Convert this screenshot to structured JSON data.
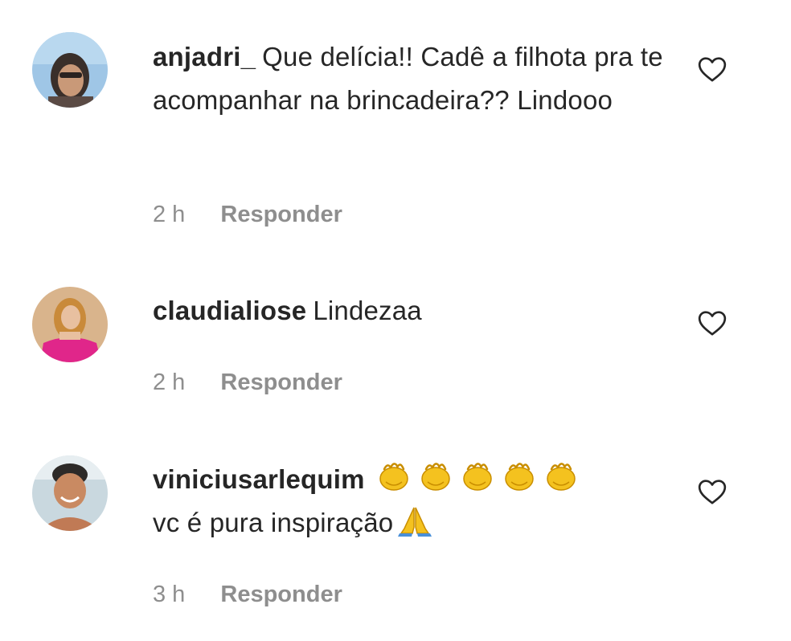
{
  "comments": [
    {
      "username": "anjadri_",
      "text": "Que delícia!! Cadê a filhota pra te acompanhar na brincadeira?? Lindooo",
      "time": "2 h",
      "reply_label": "Responder",
      "avatar_icon": "user-avatar-photo",
      "like_icon": "heart-outline-icon"
    },
    {
      "username": "claudialiose",
      "text": "Lindezaa",
      "time": "2 h",
      "reply_label": "Responder",
      "avatar_icon": "user-avatar-photo",
      "like_icon": "heart-outline-icon"
    },
    {
      "username": "viniciusarlequim",
      "text_line2": "vc é pura inspiração",
      "emoji_line1": "clapping-hands-emoji x5",
      "emoji_line2": "folded-hands-emoji",
      "time": "3 h",
      "reply_label": "Responder",
      "avatar_icon": "user-avatar-photo",
      "like_icon": "heart-outline-icon"
    }
  ],
  "colors": {
    "text": "#262626",
    "secondary": "#8e8e8e",
    "background": "#ffffff"
  }
}
